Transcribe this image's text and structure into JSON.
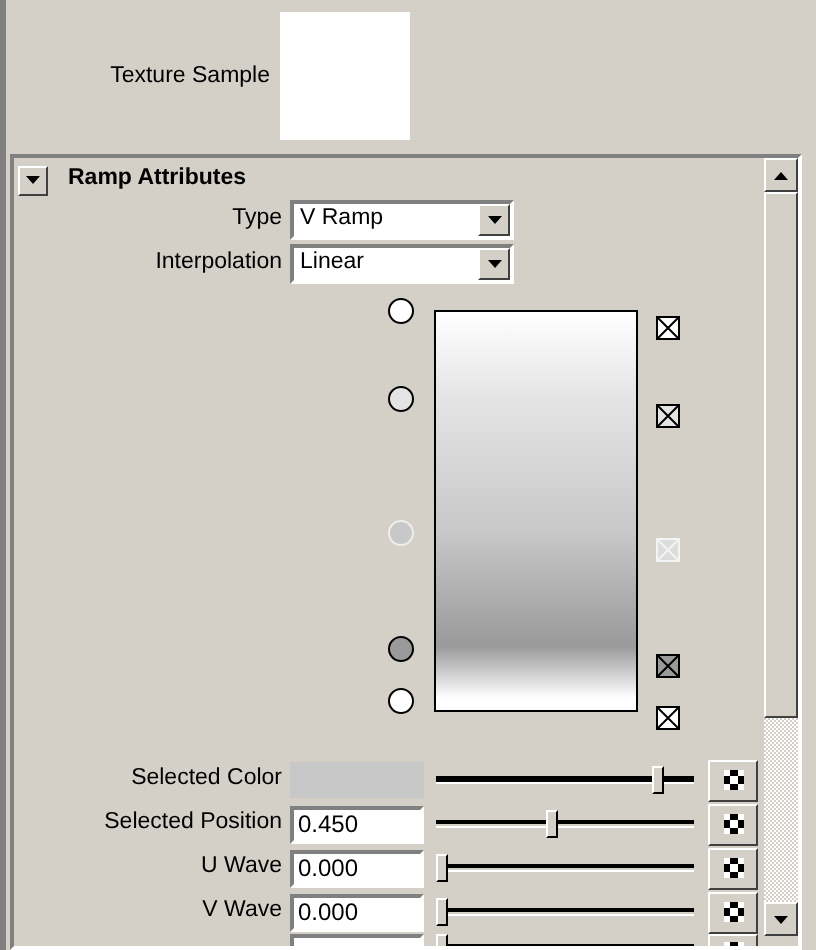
{
  "texture_sample": {
    "label": "Texture Sample"
  },
  "section": {
    "title": "Ramp Attributes",
    "expanded": true
  },
  "dropdowns": [
    {
      "label": "Type",
      "value": "V Ramp"
    },
    {
      "label": "Interpolation",
      "value": "Linear"
    }
  ],
  "ramp": {
    "entries": [
      {
        "color": "#ffffff",
        "selected": false
      },
      {
        "color": "#e4e4e4",
        "selected": false
      },
      {
        "color": "#c8c8c8",
        "selected": true
      },
      {
        "color": "#9a9a9a",
        "selected": false
      },
      {
        "color": "#ffffff",
        "selected": false
      }
    ]
  },
  "attributes": [
    {
      "kind": "color",
      "label": "Selected Color",
      "color": "#c8c8c8",
      "level": 0.88
    },
    {
      "kind": "number",
      "label": "Selected Position",
      "value": "0.450",
      "level": 0.45
    },
    {
      "kind": "number",
      "label": "U Wave",
      "value": "0.000",
      "level": 0
    },
    {
      "kind": "number",
      "label": "V Wave",
      "value": "0.000",
      "level": 0
    },
    {
      "kind": "cut",
      "level": 0
    }
  ]
}
